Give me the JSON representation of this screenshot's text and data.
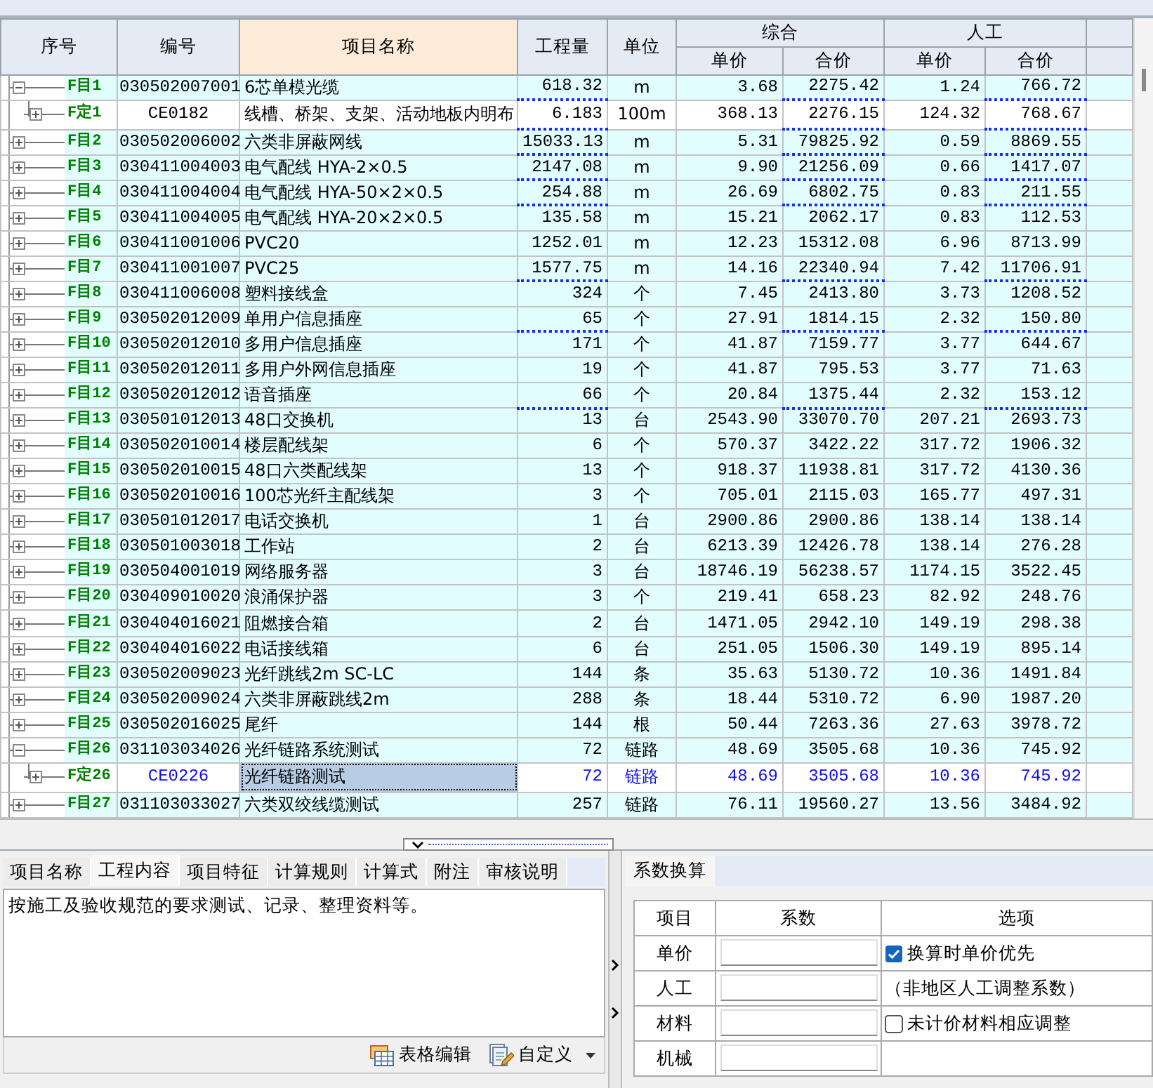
{
  "grid": {
    "columns": [
      {
        "label": "序号",
        "selected": false
      },
      {
        "label": "编号",
        "selected": false
      },
      {
        "label": "项目名称",
        "selected": true
      },
      {
        "label": "工程量",
        "selected": false
      },
      {
        "label": "单位",
        "selected": false
      }
    ],
    "groups": [
      {
        "label": "综合",
        "columns": [
          "单价",
          "合价"
        ]
      },
      {
        "label": "人工",
        "columns": [
          "单价",
          "合价"
        ]
      }
    ],
    "rows": [
      {
        "kind": "item",
        "no": "F目1",
        "code": "030502007001",
        "name": "6芯单模光缆",
        "quantity": "618.32",
        "unit": "m",
        "composite_unit_price": "3.68",
        "composite_total": "2275.42",
        "labor_unit_price": "1.24",
        "labor_total": "766.72",
        "underlined": true,
        "expanded": true,
        "selected": false,
        "children": [
          {
            "kind": "quota",
            "no": "F定1",
            "code": "CE0182",
            "name": "线槽、桥架、支架、活动地板内明布",
            "quantity": "6.183",
            "unit": "100m",
            "composite_unit_price": "368.13",
            "composite_total": "2276.15",
            "labor_unit_price": "124.32",
            "labor_total": "768.67",
            "underlined": true,
            "expanded": false,
            "selected": false
          }
        ]
      },
      {
        "kind": "item",
        "no": "F目2",
        "code": "030502006002",
        "name": "六类非屏蔽网线",
        "quantity": "15033.13",
        "unit": "m",
        "composite_unit_price": "5.31",
        "composite_total": "79825.92",
        "labor_unit_price": "0.59",
        "labor_total": "8869.55",
        "underlined": true,
        "expanded": false,
        "selected": false
      },
      {
        "kind": "item",
        "no": "F目3",
        "code": "030411004003",
        "name": "电气配线 HYA-2×0.5",
        "quantity": "2147.08",
        "unit": "m",
        "composite_unit_price": "9.90",
        "composite_total": "21256.09",
        "labor_unit_price": "0.66",
        "labor_total": "1417.07",
        "underlined": true,
        "expanded": false,
        "selected": false
      },
      {
        "kind": "item",
        "no": "F目4",
        "code": "030411004004",
        "name": "电气配线 HYA-50×2×0.5",
        "quantity": "254.88",
        "unit": "m",
        "composite_unit_price": "26.69",
        "composite_total": "6802.75",
        "labor_unit_price": "0.83",
        "labor_total": "211.55",
        "underlined": true,
        "expanded": false,
        "selected": false
      },
      {
        "kind": "item",
        "no": "F目5",
        "code": "030411004005",
        "name": "电气配线 HYA-20×2×0.5",
        "quantity": "135.58",
        "unit": "m",
        "composite_unit_price": "15.21",
        "composite_total": "2062.17",
        "labor_unit_price": "0.83",
        "labor_total": "112.53",
        "underlined": false,
        "expanded": false,
        "selected": false
      },
      {
        "kind": "item",
        "no": "F目6",
        "code": "030411001006",
        "name": "PVC20",
        "quantity": "1252.01",
        "unit": "m",
        "composite_unit_price": "12.23",
        "composite_total": "15312.08",
        "labor_unit_price": "6.96",
        "labor_total": "8713.99",
        "underlined": false,
        "expanded": false,
        "selected": false
      },
      {
        "kind": "item",
        "no": "F目7",
        "code": "030411001007",
        "name": "PVC25",
        "quantity": "1577.75",
        "unit": "m",
        "composite_unit_price": "14.16",
        "composite_total": "22340.94",
        "labor_unit_price": "7.42",
        "labor_total": "11706.91",
        "underlined": true,
        "expanded": false,
        "selected": false
      },
      {
        "kind": "item",
        "no": "F目8",
        "code": "030411006008",
        "name": "塑料接线盒",
        "quantity": "324",
        "unit": "个",
        "composite_unit_price": "7.45",
        "composite_total": "2413.80",
        "labor_unit_price": "3.73",
        "labor_total": "1208.52",
        "underlined": false,
        "expanded": false,
        "selected": false
      },
      {
        "kind": "item",
        "no": "F目9",
        "code": "030502012009",
        "name": "单用户信息插座",
        "quantity": "65",
        "unit": "个",
        "composite_unit_price": "27.91",
        "composite_total": "1814.15",
        "labor_unit_price": "2.32",
        "labor_total": "150.80",
        "underlined": true,
        "expanded": false,
        "selected": false
      },
      {
        "kind": "item",
        "no": "F目10",
        "code": "030502012010",
        "name": "多用户信息插座",
        "quantity": "171",
        "unit": "个",
        "composite_unit_price": "41.87",
        "composite_total": "7159.77",
        "labor_unit_price": "3.77",
        "labor_total": "644.67",
        "underlined": false,
        "expanded": false,
        "selected": false
      },
      {
        "kind": "item",
        "no": "F目11",
        "code": "030502012011",
        "name": "多用户外网信息插座",
        "quantity": "19",
        "unit": "个",
        "composite_unit_price": "41.87",
        "composite_total": "795.53",
        "labor_unit_price": "3.77",
        "labor_total": "71.63",
        "underlined": false,
        "expanded": false,
        "selected": false
      },
      {
        "kind": "item",
        "no": "F目12",
        "code": "030502012012",
        "name": "语音插座",
        "quantity": "66",
        "unit": "个",
        "composite_unit_price": "20.84",
        "composite_total": "1375.44",
        "labor_unit_price": "2.32",
        "labor_total": "153.12",
        "underlined": true,
        "expanded": false,
        "selected": false
      },
      {
        "kind": "item",
        "no": "F目13",
        "code": "030501012013",
        "name": "48口交换机",
        "quantity": "13",
        "unit": "台",
        "composite_unit_price": "2543.90",
        "composite_total": "33070.70",
        "labor_unit_price": "207.21",
        "labor_total": "2693.73",
        "underlined": false,
        "expanded": false,
        "selected": false
      },
      {
        "kind": "item",
        "no": "F目14",
        "code": "030502010014",
        "name": "楼层配线架",
        "quantity": "6",
        "unit": "个",
        "composite_unit_price": "570.37",
        "composite_total": "3422.22",
        "labor_unit_price": "317.72",
        "labor_total": "1906.32",
        "underlined": false,
        "expanded": false,
        "selected": false
      },
      {
        "kind": "item",
        "no": "F目15",
        "code": "030502010015",
        "name": "48口六类配线架",
        "quantity": "13",
        "unit": "个",
        "composite_unit_price": "918.37",
        "composite_total": "11938.81",
        "labor_unit_price": "317.72",
        "labor_total": "4130.36",
        "underlined": false,
        "expanded": false,
        "selected": false
      },
      {
        "kind": "item",
        "no": "F目16",
        "code": "030502010016",
        "name": "100芯光纤主配线架",
        "quantity": "3",
        "unit": "个",
        "composite_unit_price": "705.01",
        "composite_total": "2115.03",
        "labor_unit_price": "165.77",
        "labor_total": "497.31",
        "underlined": false,
        "expanded": false,
        "selected": false
      },
      {
        "kind": "item",
        "no": "F目17",
        "code": "030501012017",
        "name": "电话交换机",
        "quantity": "1",
        "unit": "台",
        "composite_unit_price": "2900.86",
        "composite_total": "2900.86",
        "labor_unit_price": "138.14",
        "labor_total": "138.14",
        "underlined": false,
        "expanded": false,
        "selected": false
      },
      {
        "kind": "item",
        "no": "F目18",
        "code": "030501003018",
        "name": "工作站",
        "quantity": "2",
        "unit": "台",
        "composite_unit_price": "6213.39",
        "composite_total": "12426.78",
        "labor_unit_price": "138.14",
        "labor_total": "276.28",
        "underlined": false,
        "expanded": false,
        "selected": false
      },
      {
        "kind": "item",
        "no": "F目19",
        "code": "030504001019",
        "name": "网络服务器",
        "quantity": "3",
        "unit": "台",
        "composite_unit_price": "18746.19",
        "composite_total": "56238.57",
        "labor_unit_price": "1174.15",
        "labor_total": "3522.45",
        "underlined": false,
        "expanded": false,
        "selected": false
      },
      {
        "kind": "item",
        "no": "F目20",
        "code": "030409010020",
        "name": "浪涌保护器",
        "quantity": "3",
        "unit": "个",
        "composite_unit_price": "219.41",
        "composite_total": "658.23",
        "labor_unit_price": "82.92",
        "labor_total": "248.76",
        "underlined": false,
        "expanded": false,
        "selected": false
      },
      {
        "kind": "item",
        "no": "F目21",
        "code": "030404016021",
        "name": "阻燃接合箱",
        "quantity": "2",
        "unit": "台",
        "composite_unit_price": "1471.05",
        "composite_total": "2942.10",
        "labor_unit_price": "149.19",
        "labor_total": "298.38",
        "underlined": false,
        "expanded": false,
        "selected": false
      },
      {
        "kind": "item",
        "no": "F目22",
        "code": "030404016022",
        "name": "电话接线箱",
        "quantity": "6",
        "unit": "台",
        "composite_unit_price": "251.05",
        "composite_total": "1506.30",
        "labor_unit_price": "149.19",
        "labor_total": "895.14",
        "underlined": false,
        "expanded": false,
        "selected": false
      },
      {
        "kind": "item",
        "no": "F目23",
        "code": "030502009023",
        "name": "光纤跳线2m SC-LC",
        "quantity": "144",
        "unit": "条",
        "composite_unit_price": "35.63",
        "composite_total": "5130.72",
        "labor_unit_price": "10.36",
        "labor_total": "1491.84",
        "underlined": false,
        "expanded": false,
        "selected": false
      },
      {
        "kind": "item",
        "no": "F目24",
        "code": "030502009024",
        "name": "六类非屏蔽跳线2m",
        "quantity": "288",
        "unit": "条",
        "composite_unit_price": "18.44",
        "composite_total": "5310.72",
        "labor_unit_price": "6.90",
        "labor_total": "1987.20",
        "underlined": false,
        "expanded": false,
        "selected": false
      },
      {
        "kind": "item",
        "no": "F目25",
        "code": "030502016025",
        "name": "尾纤",
        "quantity": "144",
        "unit": "根",
        "composite_unit_price": "50.44",
        "composite_total": "7263.36",
        "labor_unit_price": "27.63",
        "labor_total": "3978.72",
        "underlined": false,
        "expanded": false,
        "selected": false
      },
      {
        "kind": "item",
        "no": "F目26",
        "code": "031103034026",
        "name": "光纤链路系统测试",
        "quantity": "72",
        "unit": "链路",
        "composite_unit_price": "48.69",
        "composite_total": "3505.68",
        "labor_unit_price": "10.36",
        "labor_total": "745.92",
        "underlined": false,
        "expanded": true,
        "selected": false,
        "children": [
          {
            "kind": "quota",
            "no": "F定26",
            "code": "CE0226",
            "name": "光纤链路测试",
            "quantity": "72",
            "unit": "链路",
            "composite_unit_price": "48.69",
            "composite_total": "3505.68",
            "labor_unit_price": "10.36",
            "labor_total": "745.92",
            "underlined": false,
            "expanded": false,
            "selected": true
          }
        ]
      },
      {
        "kind": "item",
        "no": "F目27",
        "code": "031103033027",
        "name": "六类双绞线缆测试",
        "quantity": "257",
        "unit": "链路",
        "composite_unit_price": "76.11",
        "composite_total": "19560.27",
        "labor_unit_price": "13.56",
        "labor_total": "3484.92",
        "underlined": false,
        "expanded": false,
        "selected": false
      }
    ]
  },
  "detail_panel": {
    "tabs": [
      {
        "label": "项目名称",
        "selected": false
      },
      {
        "label": "工程内容",
        "selected": true
      },
      {
        "label": "项目特征",
        "selected": false
      },
      {
        "label": "计算规则",
        "selected": false
      },
      {
        "label": "计算式",
        "selected": false
      },
      {
        "label": "附注",
        "selected": false
      },
      {
        "label": "审核说明",
        "selected": false
      }
    ],
    "content": "按施工及验收规范的要求测试、记录、整理资料等。",
    "buttons": [
      {
        "kind": "table",
        "label": "表格编辑",
        "dropdown": false
      },
      {
        "kind": "custom",
        "label": "自定义",
        "dropdown": true
      }
    ]
  },
  "coefficient_panel": {
    "tabs": [
      {
        "label": "系数换算",
        "selected": true
      }
    ],
    "columns": [
      "项目",
      "系数",
      "选项"
    ],
    "rows": [
      {
        "item": "单价",
        "option": {
          "kind": "checkbox",
          "label": "换算时单价优先",
          "checked": true
        }
      },
      {
        "item": "人工",
        "option": {
          "kind": "note",
          "label": "（非地区人工调整系数）"
        }
      },
      {
        "item": "材料",
        "option": {
          "kind": "checkbox",
          "label": "未计价材料相应调整",
          "checked": false
        }
      },
      {
        "item": "机械"
      }
    ]
  }
}
